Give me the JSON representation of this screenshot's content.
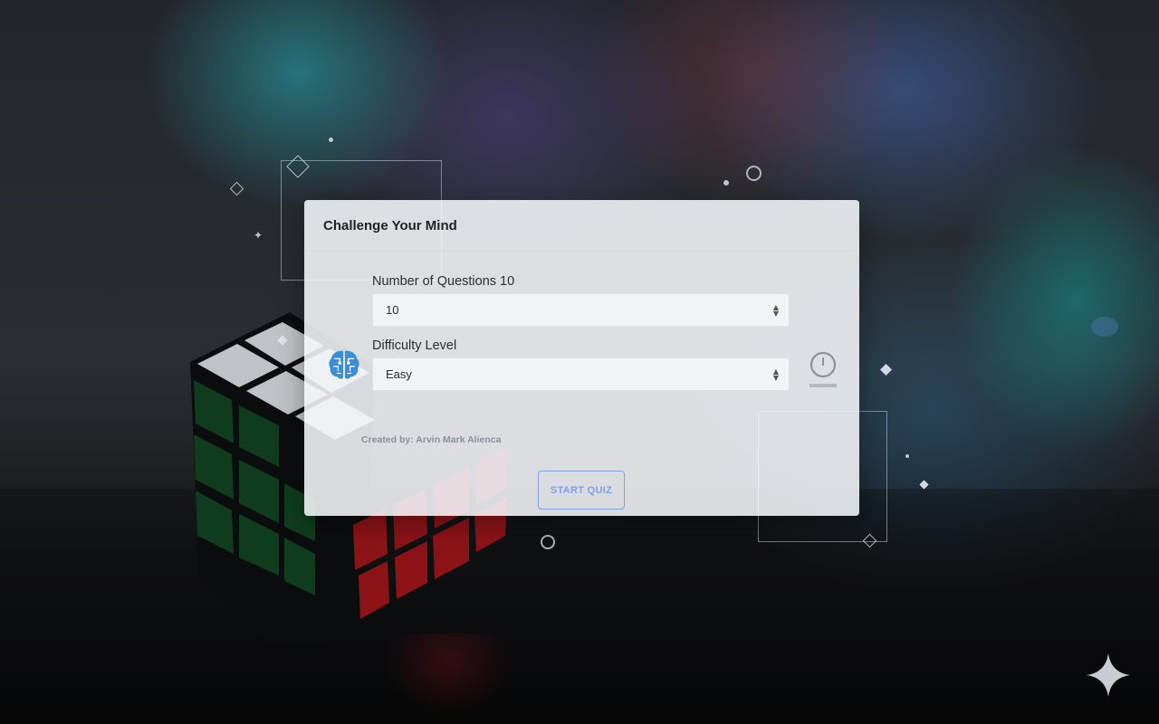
{
  "panel": {
    "title": "Challenge Your Mind",
    "questions_label": "Number of Questions 10",
    "questions_value": "10",
    "difficulty_label": "Difficulty Level",
    "difficulty_value": "Easy",
    "credit": "Created by: Arvin Mark Alienca",
    "start_label": "START QUIZ"
  },
  "icons": {
    "brain": "brain-icon",
    "timer": "timer-icon",
    "select_arrows": "updown-arrows-icon",
    "corner": "sparkle-icon"
  },
  "colors": {
    "accent": "#7da0e6",
    "brain": "#3b8fd9",
    "title": "#1e2025",
    "credit": "#8a8f99"
  }
}
